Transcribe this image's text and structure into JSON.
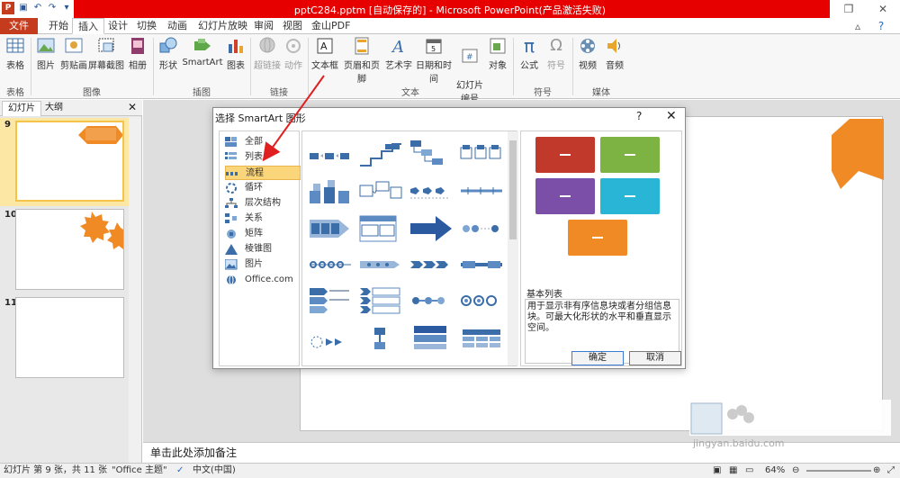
{
  "window": {
    "title": "pptC284.pptm [自动保存的] - Microsoft PowerPoint(产品激活失败)",
    "app_icon": "P"
  },
  "qat": [
    "save-icon",
    "undo-icon",
    "redo-icon",
    "customize-icon"
  ],
  "tabs": {
    "file": "文件",
    "items": [
      "开始",
      "插入",
      "设计",
      "切换",
      "动画",
      "幻灯片放映",
      "审阅",
      "视图",
      "金山PDF"
    ],
    "active": "插入"
  },
  "ribbon": {
    "buttons": {
      "table": "表格",
      "picture": "图片",
      "clipart": "剪贴画",
      "screenshot": "屏幕截图",
      "album": "相册",
      "shapes": "形状",
      "smartart": "SmartArt",
      "chart": "图表",
      "hyperlink": "超链接",
      "action": "动作",
      "textbox": "文本框",
      "headerfooter": "页眉和页脚",
      "wordart": "艺术字",
      "datetime": "日期和时间",
      "slidenumber": "幻灯片\n编号",
      "object": "对象",
      "equation": "公式",
      "symbol": "符号",
      "video": "视频",
      "audio": "音频"
    },
    "groups": {
      "tables": "表格",
      "images": "图像",
      "illustrations": "插图",
      "links": "链接",
      "text": "文本",
      "symbols": "符号",
      "media": "媒体"
    }
  },
  "left_pane": {
    "tabs": [
      "幻灯片",
      "大纲"
    ],
    "slides": [
      "9",
      "10",
      "11"
    ]
  },
  "notes_placeholder": "单击此处添加备注",
  "dialog": {
    "title": "选择 SmartArt 图形",
    "help": "?",
    "close": "✕",
    "categories": [
      {
        "label": "全部",
        "icon": "all-icon"
      },
      {
        "label": "列表",
        "icon": "list-icon"
      },
      {
        "label": "流程",
        "icon": "process-icon"
      },
      {
        "label": "循环",
        "icon": "cycle-icon"
      },
      {
        "label": "层次结构",
        "icon": "hierarchy-icon"
      },
      {
        "label": "关系",
        "icon": "relationship-icon"
      },
      {
        "label": "矩阵",
        "icon": "matrix-icon"
      },
      {
        "label": "棱锥图",
        "icon": "pyramid-icon"
      },
      {
        "label": "图片",
        "icon": "picture-icon"
      },
      {
        "label": "Office.com",
        "icon": "office-icon"
      }
    ],
    "selected_category": "流程",
    "preview": {
      "name": "基本列表",
      "description": "用于显示非有序信息块或者分组信息块。可最大化形状的水平和垂直显示空间。",
      "colors": [
        "#c0392b",
        "#7cb342",
        "#7b4fa8",
        "#29b6d6",
        "#f08a24"
      ]
    },
    "ok": "确定",
    "cancel": "取消"
  },
  "status": {
    "slide_info": "幻灯片 第 9 张，共 11 张",
    "theme": "\"Office 主题\"",
    "language": "中文(中国)",
    "zoom": "64%"
  },
  "watermark": {
    "url": "jingyan.baidu.com"
  }
}
